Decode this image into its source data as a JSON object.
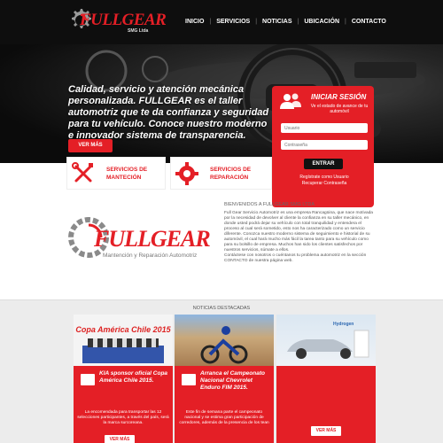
{
  "header": {
    "brand": "FULLGEAR",
    "brand_sub": "SMG Ltda",
    "nav": [
      "INICIO",
      "SERVICIOS",
      "NOTICIAS",
      "UBICACIÓN",
      "CONTACTO"
    ]
  },
  "hero": {
    "headline": "Calidad, servicio y atención mecánica personalizada. FULLGEAR es el taller automotriz que te da confianza y seguridad para tu vehículo. Conoce nuestro moderno e innovador sistema de transparencia.",
    "button": "VER MÁS"
  },
  "login": {
    "title": "INICIAR SESIÓN",
    "subtitle": "Ve el estado de avance de tu automóvil",
    "user_placeholder": "Usuario",
    "password_placeholder": "Contraseña",
    "submit": "ENTRAR",
    "register": "Regístrate como Usuario",
    "recover": "Recuperar Contraseña"
  },
  "services": {
    "maintenance": "SERVICIOS DE MANTECIÓN",
    "repair": "SERVICIOS DE REPARACIÓN"
  },
  "about": {
    "logo_brand": "FULLGEAR",
    "logo_tagline": "Mantención y Reparación Automotriz",
    "title": "BIENVENIDOS A FULLGEAR SMG LTDA",
    "paragraph1": "Full Gear Servicio Automotriz es una empresa Rancagüina, que nace motivada por la necesidad de devolver al cliente la confianza en su taller mecánico, en donde usted podrá dejar su vehículo con total tranquilidad y entendera el proceso al cual será sometido, esto nos ha caracterizado como un servicio diferente. Conozca nuestro moderno sistema de seguimiento e historial de su automóvil, el cual hará mucho más fácil la tarea tanto para su vehículo como para su bolsillo de empresa. Muchos han sido los clientes satisfechos por nuestros servicios, súmate a ellos.",
    "paragraph2": "Contáctese con nosotros o cuéntanos tu problema automotriz en la sección CONTACTO de nuestra página web."
  },
  "news": {
    "heading": "NOTICIAS DESTACADAS",
    "cards": [
      {
        "image_caption": "Copa América Chile 2015",
        "title": "KIA sponsor oficial Copa América Chile 2015.",
        "text": "La encomendada para transportar las 12 selecciones participantes, a través del país, será la marca surcoreana.",
        "button": "VER MÁS"
      },
      {
        "title": "Arranca el Campeonato Nacional Chevrolet Enduro FIM 2015.",
        "text": "Este fin de semana parte el campeonato nacional y se estima gran participación de corredores, además de la presencia de los tean",
        "button": "VER MÁS"
      },
      {
        "image_caption": "Hydrogen",
        "title": "",
        "text": "",
        "button": "VER MÁS"
      }
    ]
  },
  "colors": {
    "brand_red": "#e41f26",
    "header_bg": "#0e0e0e"
  },
  "icons": [
    "gear-icon",
    "user-group-icon",
    "tools-icon",
    "engine-gear-icon",
    "news-icon"
  ]
}
